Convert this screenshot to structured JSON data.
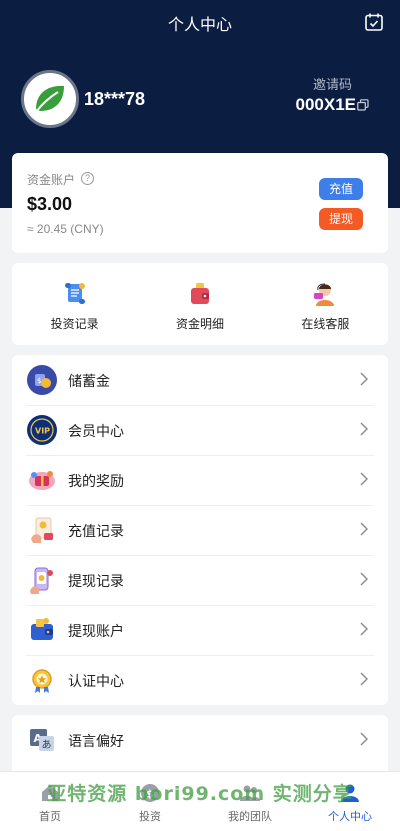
{
  "header": {
    "title": "个人中心",
    "username": "18***78",
    "invite_label": "邀请码",
    "invite_code": "000X1E"
  },
  "account": {
    "label": "资金账户",
    "amount": "$3.00",
    "cny": "≈ 20.45 (CNY)",
    "recharge_label": "充值",
    "withdraw_label": "提现"
  },
  "quick_links": [
    {
      "label": "投资记录",
      "icon": "scroll-icon"
    },
    {
      "label": "资金明细",
      "icon": "wallet-icon"
    },
    {
      "label": "在线客服",
      "icon": "customer-service-icon"
    }
  ],
  "menu": [
    {
      "label": "储蓄金",
      "icon": "savings-icon"
    },
    {
      "label": "会员中心",
      "icon": "vip-badge-icon"
    },
    {
      "label": "我的奖励",
      "icon": "gift-icon"
    },
    {
      "label": "充值记录",
      "icon": "recharge-record-icon"
    },
    {
      "label": "提现记录",
      "icon": "withdraw-record-icon"
    },
    {
      "label": "提现账户",
      "icon": "withdraw-account-icon"
    },
    {
      "label": "认证中心",
      "icon": "medal-icon"
    },
    {
      "label": "语言偏好",
      "icon": "language-icon"
    }
  ],
  "tabs": [
    {
      "label": "首页",
      "icon": "home-icon"
    },
    {
      "label": "投资",
      "icon": "invest-icon"
    },
    {
      "label": "我的团队",
      "icon": "team-icon"
    },
    {
      "label": "个人中心",
      "icon": "profile-icon"
    }
  ],
  "watermark": "亚特资源 bori99.com 实测分享",
  "colors": {
    "header_bg": "#0c1d42",
    "recharge": "#3d7ee8",
    "withdraw": "#f45a25",
    "active_tab": "#1f5fd6"
  }
}
